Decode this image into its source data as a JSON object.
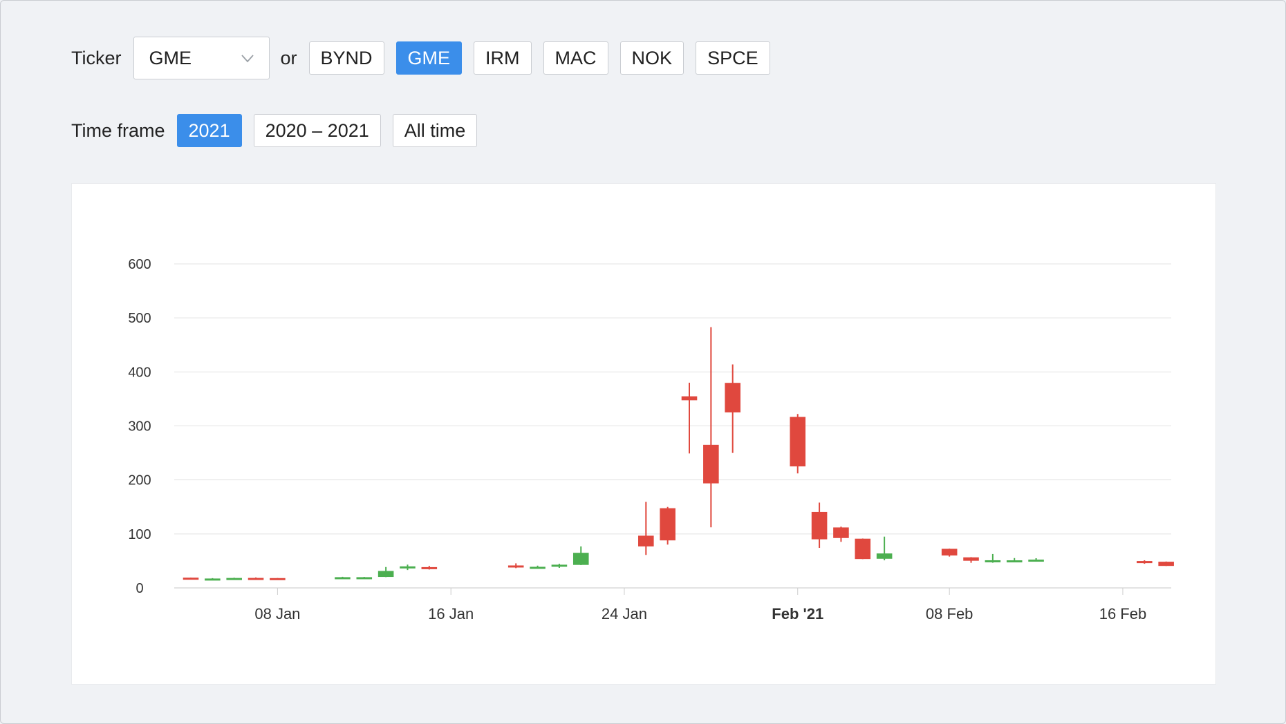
{
  "ticker": {
    "label": "Ticker",
    "selected": "GME",
    "or_label": "or",
    "options": [
      "BYND",
      "GME",
      "IRM",
      "MAC",
      "NOK",
      "SPCE"
    ],
    "active": "GME"
  },
  "timeframe": {
    "label": "Time frame",
    "options": [
      "2021",
      "2020 – 2021",
      "All time"
    ],
    "active": "2021"
  },
  "colors": {
    "up": "#4caf50",
    "down": "#e0483e",
    "accent": "#3b8eea",
    "grid": "#e3e3e3"
  },
  "chart_data": {
    "type": "candlestick",
    "title": "",
    "xlabel": "",
    "ylabel": "",
    "ylim": [
      0,
      600
    ],
    "y_ticks": [
      0,
      100,
      200,
      300,
      400,
      500,
      600
    ],
    "x_range": [
      "2021-01-04",
      "2021-02-19"
    ],
    "x_ticks": [
      {
        "date": "2021-01-08",
        "label": "08 Jan",
        "bold": false
      },
      {
        "date": "2021-01-16",
        "label": "16 Jan",
        "bold": false
      },
      {
        "date": "2021-01-24",
        "label": "24 Jan",
        "bold": false
      },
      {
        "date": "2021-02-01",
        "label": "Feb '21",
        "bold": true
      },
      {
        "date": "2021-02-08",
        "label": "08 Feb",
        "bold": false
      },
      {
        "date": "2021-02-16",
        "label": "16 Feb",
        "bold": false
      }
    ],
    "grid": true,
    "candles": [
      {
        "date": "2021-01-04",
        "open": 19.0,
        "high": 19.1,
        "low": 17.2,
        "close": 17.3
      },
      {
        "date": "2021-01-05",
        "open": 17.3,
        "high": 18.1,
        "low": 17.2,
        "close": 17.4
      },
      {
        "date": "2021-01-06",
        "open": 17.3,
        "high": 18.9,
        "low": 17.1,
        "close": 18.4
      },
      {
        "date": "2021-01-07",
        "open": 18.5,
        "high": 19.4,
        "low": 18.0,
        "close": 18.1
      },
      {
        "date": "2021-01-08",
        "open": 18.2,
        "high": 18.3,
        "low": 17.1,
        "close": 17.7
      },
      {
        "date": "2021-01-11",
        "open": 19.4,
        "high": 20.6,
        "low": 19.0,
        "close": 19.9
      },
      {
        "date": "2021-01-12",
        "open": 19.9,
        "high": 20.4,
        "low": 19.0,
        "close": 19.9
      },
      {
        "date": "2021-01-13",
        "open": 20.4,
        "high": 38.7,
        "low": 20.0,
        "close": 31.4
      },
      {
        "date": "2021-01-14",
        "open": 38.5,
        "high": 43.1,
        "low": 33.1,
        "close": 39.9
      },
      {
        "date": "2021-01-15",
        "open": 38.5,
        "high": 40.8,
        "low": 34.0,
        "close": 35.5
      },
      {
        "date": "2021-01-19",
        "open": 41.6,
        "high": 45.5,
        "low": 36.6,
        "close": 39.4
      },
      {
        "date": "2021-01-20",
        "open": 37.4,
        "high": 41.2,
        "low": 36.1,
        "close": 39.1
      },
      {
        "date": "2021-01-21",
        "open": 39.2,
        "high": 44.8,
        "low": 37.1,
        "close": 43.0
      },
      {
        "date": "2021-01-22",
        "open": 42.6,
        "high": 76.8,
        "low": 42.3,
        "close": 65.0
      },
      {
        "date": "2021-01-25",
        "open": 96.7,
        "high": 159.2,
        "low": 61.1,
        "close": 76.8
      },
      {
        "date": "2021-01-26",
        "open": 147.6,
        "high": 150.0,
        "low": 80.2,
        "close": 88.0
      },
      {
        "date": "2021-01-27",
        "open": 354.8,
        "high": 380.0,
        "low": 249.0,
        "close": 347.5
      },
      {
        "date": "2021-01-28",
        "open": 265.0,
        "high": 483.0,
        "low": 112.3,
        "close": 193.6
      },
      {
        "date": "2021-01-29",
        "open": 379.7,
        "high": 413.9,
        "low": 250.0,
        "close": 325.0
      },
      {
        "date": "2021-02-01",
        "open": 316.6,
        "high": 322.0,
        "low": 212.0,
        "close": 225.0
      },
      {
        "date": "2021-02-02",
        "open": 140.8,
        "high": 158.0,
        "low": 74.2,
        "close": 90.0
      },
      {
        "date": "2021-02-03",
        "open": 112.0,
        "high": 113.4,
        "low": 85.3,
        "close": 92.4
      },
      {
        "date": "2021-02-04",
        "open": 91.2,
        "high": 91.5,
        "low": 53.3,
        "close": 53.5
      },
      {
        "date": "2021-02-05",
        "open": 54.0,
        "high": 95.0,
        "low": 51.1,
        "close": 63.8
      },
      {
        "date": "2021-02-08",
        "open": 72.4,
        "high": 72.7,
        "low": 58.0,
        "close": 60.0
      },
      {
        "date": "2021-02-09",
        "open": 56.6,
        "high": 57.0,
        "low": 46.5,
        "close": 50.3
      },
      {
        "date": "2021-02-10",
        "open": 50.8,
        "high": 62.8,
        "low": 46.6,
        "close": 51.2
      },
      {
        "date": "2021-02-11",
        "open": 50.0,
        "high": 55.3,
        "low": 48.2,
        "close": 51.1
      },
      {
        "date": "2021-02-12",
        "open": 50.8,
        "high": 55.0,
        "low": 49.0,
        "close": 52.4
      },
      {
        "date": "2021-02-17",
        "open": 49.8,
        "high": 51.2,
        "low": 44.7,
        "close": 45.9
      },
      {
        "date": "2021-02-18",
        "open": 48.5,
        "high": 48.9,
        "low": 40.6,
        "close": 40.7
      }
    ]
  }
}
